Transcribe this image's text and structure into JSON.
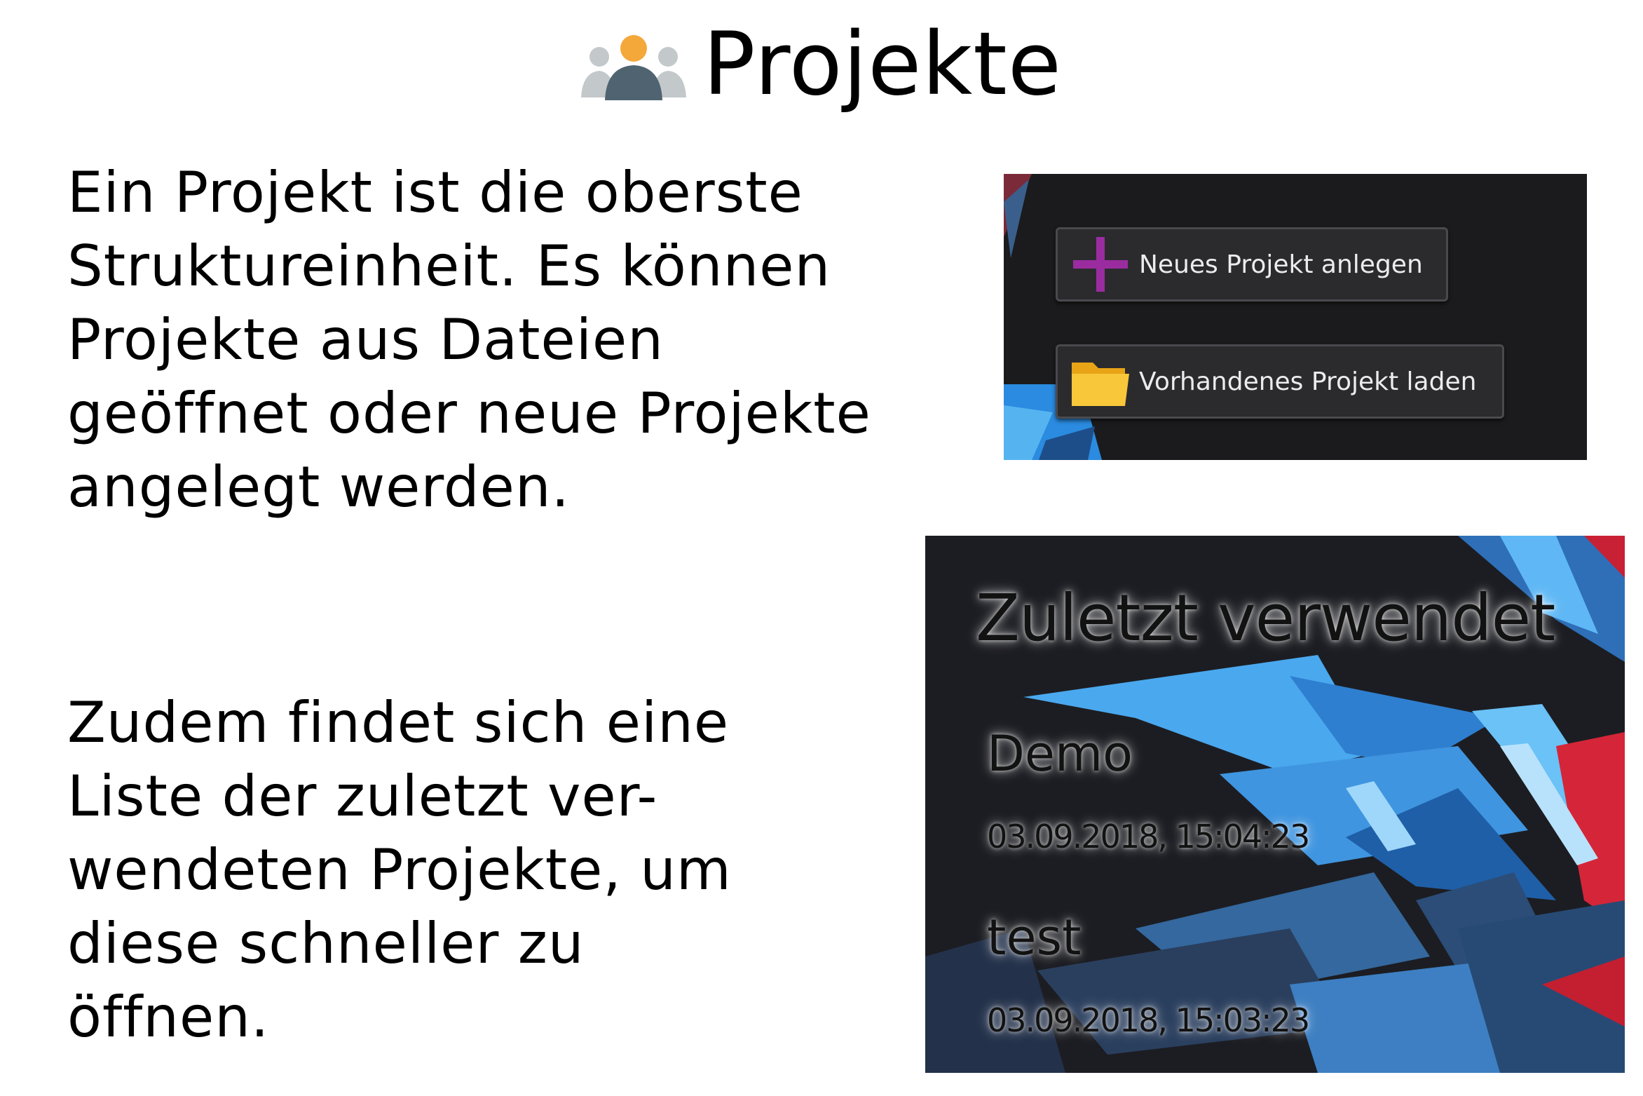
{
  "title": {
    "text": "Projekte",
    "icon": "users-group-icon"
  },
  "intro_text": {
    "lines": [
      "Ein Projekt ist die oberste",
      "Struktureinheit. Es können",
      "Projekte aus Dateien",
      "geöffnet oder neue Projekte",
      "angelegt werden."
    ]
  },
  "recent_text": {
    "lines": [
      "Zudem findet sich eine",
      "Liste der zuletzt ver-",
      "wendeten Projekte, um",
      "diese schneller zu",
      "öffnen."
    ]
  },
  "buttons_panel": {
    "new_project": {
      "label": "Neues Projekt anlegen",
      "icon": "plus-icon"
    },
    "load_project": {
      "label": "Vorhandenes Projekt laden",
      "icon": "folder-icon"
    }
  },
  "recent_panel": {
    "heading": "Zuletzt verwendet",
    "items": [
      {
        "name": "Demo",
        "date": "03.09.2018, 15:04:23"
      },
      {
        "name": "test",
        "date": "03.09.2018, 15:03:23"
      }
    ]
  },
  "colors": {
    "plus_purple": "#9b2ca0",
    "folder_yellow": "#f5b921",
    "icon_orange": "#f4a83a",
    "icon_slate": "#4f6470",
    "icon_grey": "#c3c8cb",
    "shard_blue": "#3b9ee8",
    "shard_red": "#d8283a"
  }
}
